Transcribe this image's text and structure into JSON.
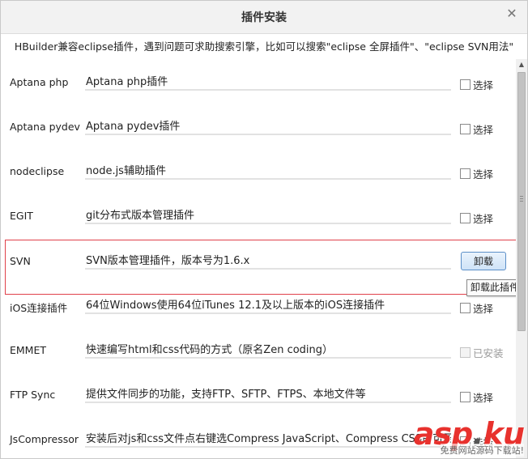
{
  "dialog": {
    "title": "插件安装",
    "hint": "HBuilder兼容eclipse插件，遇到问题可求助搜索引擎，比如可以搜索\"eclipse 全屏插件\"、\"eclipse SVN用法\""
  },
  "plugins": [
    {
      "name": "Aptana php",
      "desc": "Aptana php插件",
      "action": "选择",
      "state": "unchecked"
    },
    {
      "name": "Aptana pydev",
      "desc": "Aptana pydev插件",
      "action": "选择",
      "state": "unchecked"
    },
    {
      "name": "nodeclipse",
      "desc": "node.js辅助插件",
      "action": "选择",
      "state": "unchecked"
    },
    {
      "name": "EGIT",
      "desc": "git分布式版本管理插件",
      "action": "选择",
      "state": "unchecked"
    },
    {
      "name": "SVN",
      "desc": "SVN版本管理插件，版本号为1.6.x",
      "action": "卸载",
      "state": "installed-button"
    },
    {
      "name": "iOS连接插件",
      "desc": "64位Windows使用64位iTunes 12.1及以上版本的iOS连接插件",
      "action": "选择",
      "state": "unchecked"
    },
    {
      "name": "EMMET",
      "desc": "快速编写html和css代码的方式（原名Zen coding）",
      "action": "已安装",
      "state": "disabled"
    },
    {
      "name": "FTP Sync",
      "desc": "提供文件同步的功能，支持FTP、SFTP、FTPS、本地文件等",
      "action": "选择",
      "state": "unchecked"
    },
    {
      "name": "JsCompressor",
      "desc": "安装后对js和css文件点右键选Compress JavaScript、Compress CSS即可压缩",
      "action": "选择",
      "state": "unchecked"
    }
  ],
  "tooltip": "卸载此插件",
  "watermark": {
    "brand_a": "asp",
    "brand_b": "ku",
    "dot": ".",
    "sub": "免费网站源码下载站!"
  },
  "colors": {
    "highlight": "#e0414a",
    "button_border": "#5b8fc8",
    "watermark": "#e8322e"
  }
}
